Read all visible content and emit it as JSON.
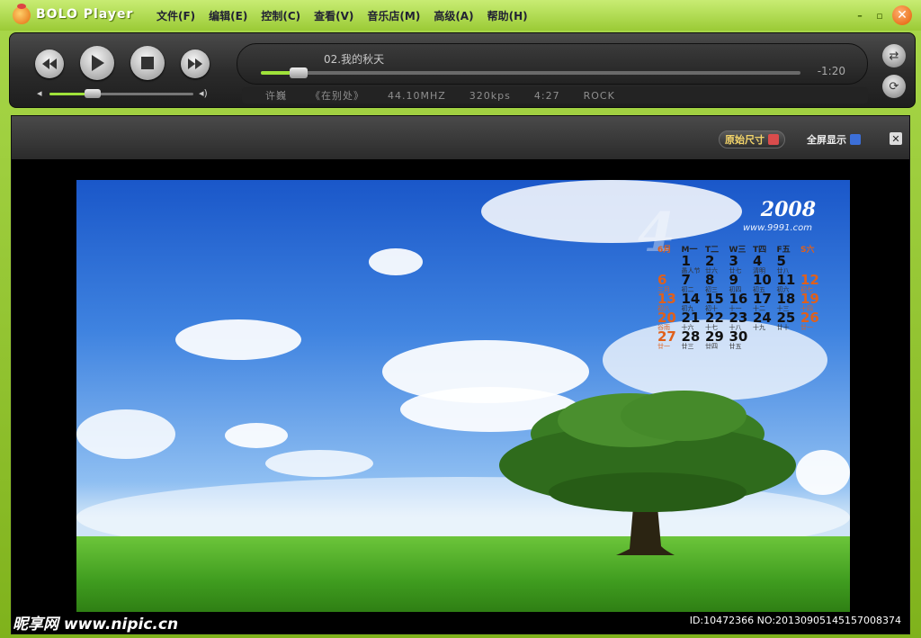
{
  "titlebar": {
    "app_name": "BOLO Player",
    "menu": [
      "文件(F)",
      "编辑(E)",
      "控制(C)",
      "查看(V)",
      "音乐店(M)",
      "高级(A)",
      "帮助(H)"
    ],
    "minimize_glyph": "–",
    "restore_glyph": "▫",
    "close_glyph": "✕"
  },
  "player": {
    "track_title": "02.我的秋天",
    "time_display": "-1:20",
    "seek_progress": 0.06,
    "volume_level": 0.27,
    "info": [
      "许巍",
      "《在别处》",
      "44.10MHZ",
      "320kps",
      "4:27",
      "ROCK"
    ]
  },
  "video_toolbar": {
    "original_size_label": "原始尺寸",
    "fullscreen_label": "全屏显示",
    "close_glyph": "✕"
  },
  "calendar": {
    "year": "2008",
    "month": "4",
    "site": "www.9991.com",
    "headers": [
      "6月",
      "M一",
      "T二",
      "W三",
      "T四",
      "F五",
      "S六"
    ],
    "cells": [
      {
        "n": "",
        "l": ""
      },
      {
        "n": "1",
        "l": "愚人节"
      },
      {
        "n": "2",
        "l": "廿六"
      },
      {
        "n": "3",
        "l": "廿七"
      },
      {
        "n": "4",
        "l": "清明"
      },
      {
        "n": "5",
        "l": "廿八"
      },
      {
        "n": "",
        "l": ""
      },
      {
        "n": "6",
        "l": "三月"
      },
      {
        "n": "7",
        "l": "初二"
      },
      {
        "n": "8",
        "l": "初三"
      },
      {
        "n": "9",
        "l": "初四"
      },
      {
        "n": "10",
        "l": "初五"
      },
      {
        "n": "11",
        "l": "初六"
      },
      {
        "n": "12",
        "l": "初七"
      },
      {
        "n": "13",
        "l": "初八"
      },
      {
        "n": "14",
        "l": "初九"
      },
      {
        "n": "15",
        "l": "初十"
      },
      {
        "n": "16",
        "l": "十一"
      },
      {
        "n": "17",
        "l": "十二"
      },
      {
        "n": "18",
        "l": "十三"
      },
      {
        "n": "19",
        "l": "十四"
      },
      {
        "n": "20",
        "l": "谷雨"
      },
      {
        "n": "21",
        "l": "十六"
      },
      {
        "n": "22",
        "l": "十七"
      },
      {
        "n": "23",
        "l": "十八"
      },
      {
        "n": "24",
        "l": "十九"
      },
      {
        "n": "25",
        "l": "廿十"
      },
      {
        "n": "26",
        "l": "廿一"
      },
      {
        "n": "27",
        "l": "廿一"
      },
      {
        "n": "28",
        "l": "廿三"
      },
      {
        "n": "29",
        "l": "廿四"
      },
      {
        "n": "30",
        "l": "廿五"
      },
      {
        "n": "",
        "l": ""
      },
      {
        "n": "",
        "l": ""
      },
      {
        "n": "",
        "l": ""
      }
    ]
  },
  "watermark": {
    "left": "昵享网 www.nipic.cn",
    "right": "ID:10472366 NO:20130905145157008374"
  }
}
